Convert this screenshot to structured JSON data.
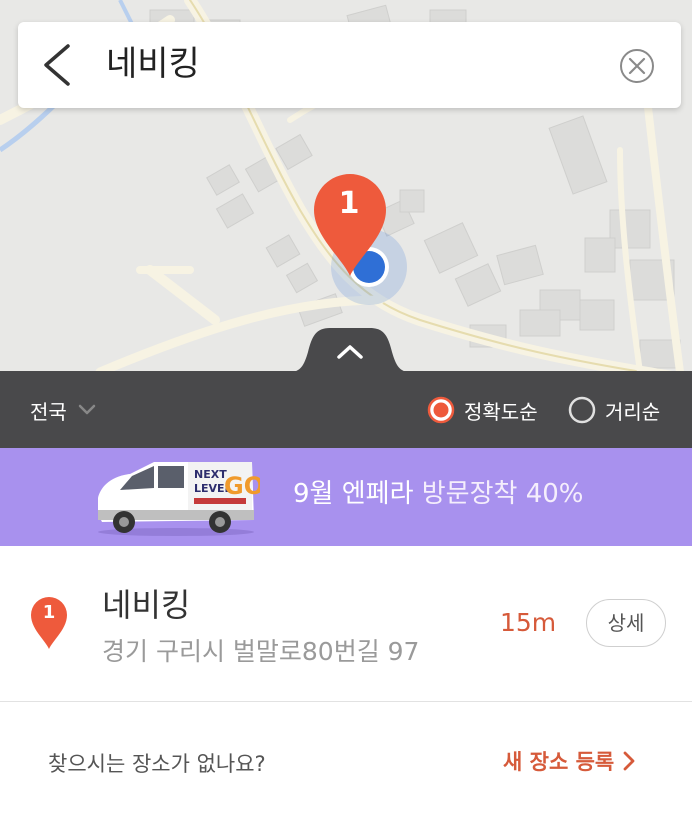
{
  "search": {
    "query": "네비킹"
  },
  "map": {
    "marker_number": "1"
  },
  "filter": {
    "region": "전국",
    "sort_options": [
      {
        "label": "정확도순",
        "selected": true
      },
      {
        "label": "거리순",
        "selected": false
      }
    ]
  },
  "banner": {
    "van_text_line1": "NEXT",
    "van_text_line2": "LEVEL",
    "van_text_go": "GO",
    "text_white": "9월 엔페라",
    "text_light": "방문장착 40%"
  },
  "results": [
    {
      "number": "1",
      "name": "네비킹",
      "address": "경기 구리시 벌말로80번길 97",
      "distance": "15m",
      "detail_label": "상세"
    }
  ],
  "footer": {
    "question": "찾으시는 장소가 없나요?",
    "register_label": "새 장소 등록"
  },
  "colors": {
    "accent": "#d65a3a",
    "marker": "#ee5a3c",
    "filter_bar": "#49494b",
    "banner": "#a891ee",
    "location_dot": "#2f6fd6"
  },
  "icons": [
    "back-arrow-icon",
    "clear-icon",
    "chevron-up-icon",
    "chevron-down-icon",
    "radio-selected-icon",
    "radio-unselected-icon",
    "map-pin-icon",
    "chevron-right-icon"
  ]
}
